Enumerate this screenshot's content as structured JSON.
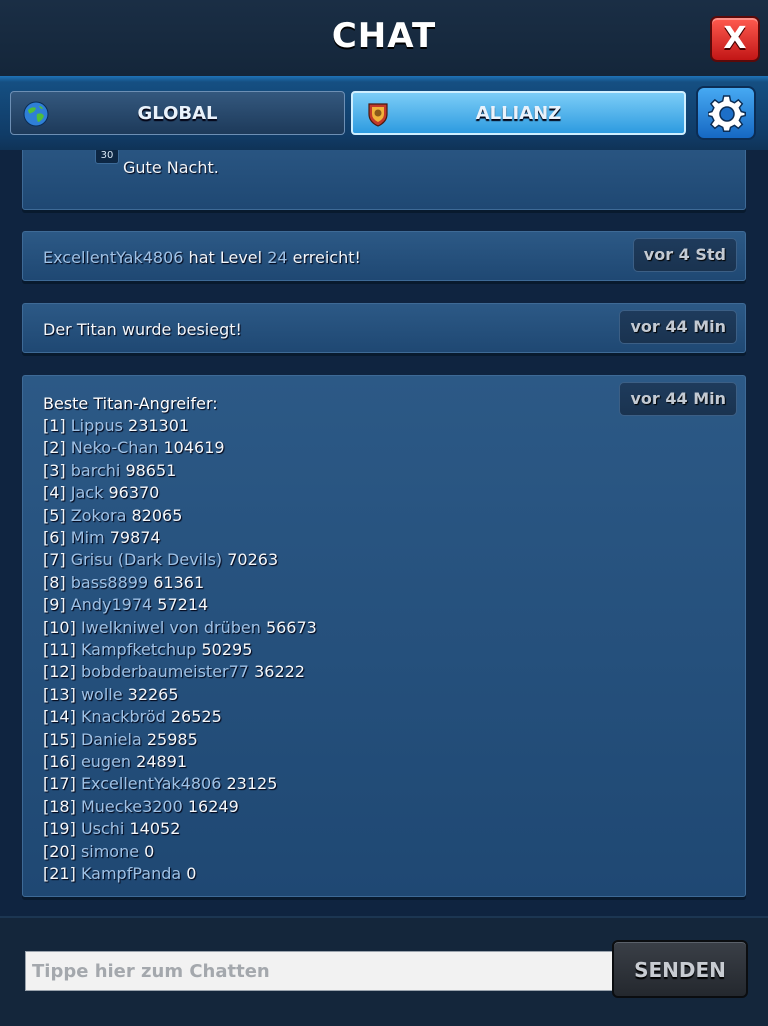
{
  "header": {
    "title": "CHAT",
    "close_label": "X"
  },
  "tabs": [
    {
      "label": "GLOBAL",
      "active": false
    },
    {
      "label": "ALLIANZ",
      "active": true
    }
  ],
  "messages": {
    "first": {
      "level": "30",
      "text": "Gute Nacht."
    },
    "levelup": {
      "player": "ExcellentYak4806",
      "pre": "hat Level",
      "level": "24",
      "post": "erreicht!",
      "time": "vor 4 Std"
    },
    "titan": {
      "text": "Der Titan wurde besiegt!",
      "time": "vor 44 Min"
    },
    "leaderboard": {
      "title": "Beste Titan-Angreifer:",
      "time": "vor 44 Min",
      "rows": [
        {
          "rank": "[1]",
          "name": "Lippus",
          "score": "231301"
        },
        {
          "rank": "[2]",
          "name": "Neko-Chan",
          "score": "104619"
        },
        {
          "rank": "[3]",
          "name": "barchi",
          "score": "98651"
        },
        {
          "rank": "[4]",
          "name": "Jack",
          "score": "96370"
        },
        {
          "rank": "[5]",
          "name": "Zokora",
          "score": "82065"
        },
        {
          "rank": "[6]",
          "name": "Mim",
          "score": "79874"
        },
        {
          "rank": "[7]",
          "name": "Grisu (Dark Devils)",
          "score": "70263"
        },
        {
          "rank": "[8]",
          "name": "bass8899",
          "score": "61361"
        },
        {
          "rank": "[9]",
          "name": "Andy1974",
          "score": "57214"
        },
        {
          "rank": "[10]",
          "name": "Iwelkniwel von drüben",
          "score": "56673"
        },
        {
          "rank": "[11]",
          "name": "Kampfketchup",
          "score": "50295"
        },
        {
          "rank": "[12]",
          "name": "bobderbaumeister77",
          "score": "36222"
        },
        {
          "rank": "[13]",
          "name": "wolle",
          "score": "32265"
        },
        {
          "rank": "[14]",
          "name": "Knackbröd",
          "score": "26525"
        },
        {
          "rank": "[15]",
          "name": "Daniela",
          "score": "25985"
        },
        {
          "rank": "[16]",
          "name": "eugen",
          "score": "24891"
        },
        {
          "rank": "[17]",
          "name": "ExcellentYak4806",
          "score": "23125"
        },
        {
          "rank": "[18]",
          "name": "Muecke3200",
          "score": "16249"
        },
        {
          "rank": "[19]",
          "name": "Uschi",
          "score": "14052"
        },
        {
          "rank": "[20]",
          "name": "simone",
          "score": "0"
        },
        {
          "rank": "[21]",
          "name": "KampfPanda",
          "score": "0"
        }
      ]
    }
  },
  "input": {
    "placeholder": "Tippe hier zum Chatten",
    "value": ""
  },
  "send_label": "SENDEN",
  "icons": {
    "close": "close-icon",
    "globe": "globe-icon",
    "alliance": "alliance-crest-icon",
    "settings": "gear-icon"
  },
  "colors": {
    "accent": "#2d9be0",
    "close": "#d9231d",
    "name": "#9fc2e6"
  }
}
